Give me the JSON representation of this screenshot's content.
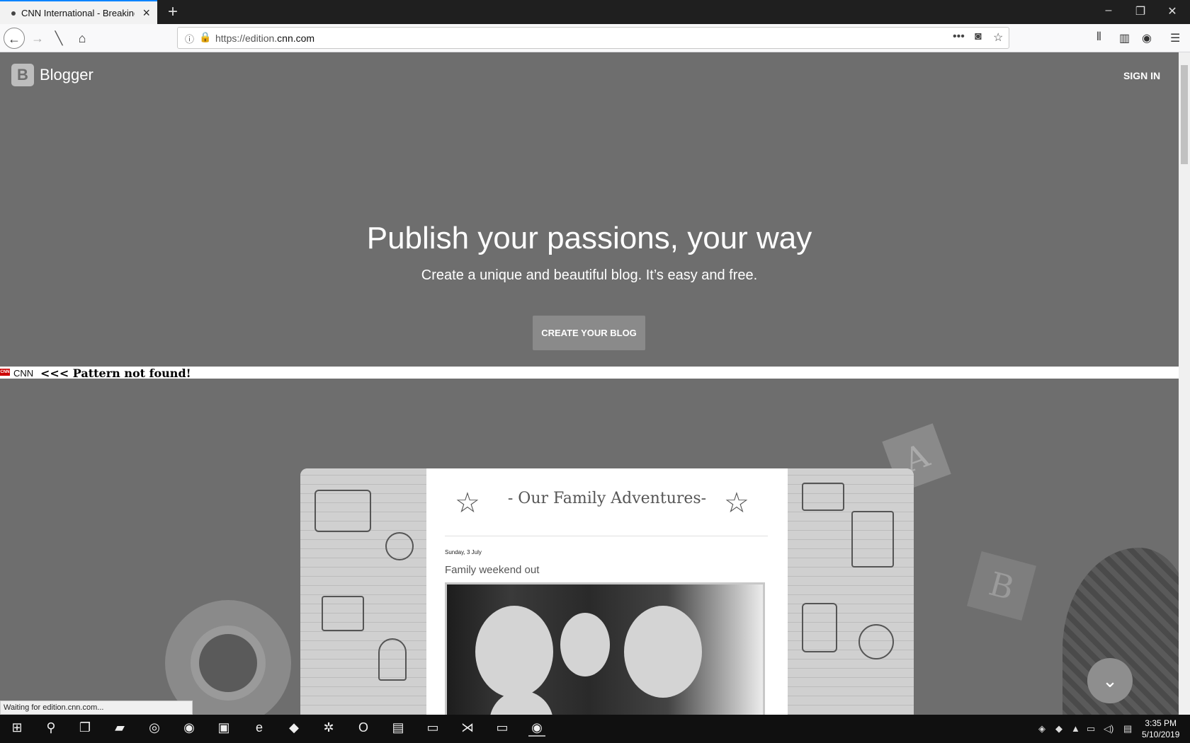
{
  "browser": {
    "tab_title": "CNN International - Breaking N",
    "url_prefix": "https://edition.",
    "url_domain": "cnn.com",
    "status_text": "Waiting for edition.cnn.com..."
  },
  "blogger": {
    "brand": "Blogger",
    "sign_in": "SIGN IN",
    "hero_title": "Publish your passions, your way",
    "hero_subtitle": "Create a unique and beautiful blog. It’s easy and free.",
    "cta": "CREATE YOUR BLOG"
  },
  "overlay": {
    "cnn_label": "CNN",
    "message": "<<< Pattern not found!"
  },
  "mock_blog": {
    "title": "- Our Family Adventures-",
    "post_date": "Sunday, 3 July",
    "post_title": "Family weekend out"
  },
  "taskbar": {
    "time": "3:35 PM",
    "date": "5/10/2019"
  },
  "colors": {
    "page_bg": "#6e6e6e",
    "tab_accent": "#0a84ff",
    "cnn_red": "#cc0000"
  }
}
